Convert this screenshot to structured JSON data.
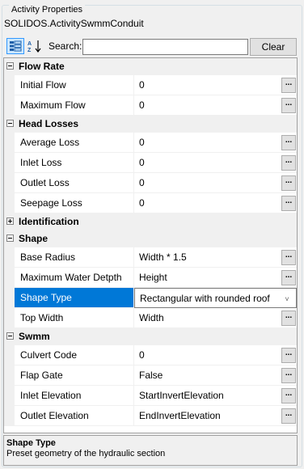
{
  "window": {
    "group_title": "Activity Properties",
    "object_name": "SOLIDOS.ActivitySwmmConduit"
  },
  "toolbar": {
    "categorized_icon": "categorized-view-icon",
    "alphabetical_icon": "alphabetical-sort-icon",
    "search_label": "Search:",
    "search_value": "",
    "clear_label": "Clear"
  },
  "grid": {
    "categories": [
      {
        "label": "Flow Rate",
        "expanded": true,
        "props": [
          {
            "name": "Initial Flow",
            "value": "0",
            "editor": "ellipsis"
          },
          {
            "name": "Maximum Flow",
            "value": "0",
            "editor": "ellipsis"
          }
        ]
      },
      {
        "label": "Head Losses",
        "expanded": true,
        "props": [
          {
            "name": "Average Loss",
            "value": "0",
            "editor": "ellipsis"
          },
          {
            "name": "Inlet Loss",
            "value": "0",
            "editor": "ellipsis"
          },
          {
            "name": "Outlet Loss",
            "value": "0",
            "editor": "ellipsis"
          },
          {
            "name": "Seepage Loss",
            "value": "0",
            "editor": "ellipsis"
          }
        ]
      },
      {
        "label": "Identification",
        "expanded": false,
        "props": []
      },
      {
        "label": "Shape",
        "expanded": true,
        "props": [
          {
            "name": "Base Radius",
            "value": "Width * 1.5",
            "editor": "ellipsis"
          },
          {
            "name": "Maximum Water Detpth",
            "value": "Height",
            "editor": "ellipsis"
          },
          {
            "name": "Shape Type",
            "value": "Rectangular with rounded roof",
            "editor": "dropdown",
            "selected": true
          },
          {
            "name": "Top Width",
            "value": "Width",
            "editor": "ellipsis"
          }
        ]
      },
      {
        "label": "Swmm",
        "expanded": true,
        "props": [
          {
            "name": "Culvert Code",
            "value": "0",
            "editor": "ellipsis"
          },
          {
            "name": "Flap Gate",
            "value": "False",
            "editor": "ellipsis"
          },
          {
            "name": "Inlet Elevation",
            "value": "StartInvertElevation",
            "editor": "ellipsis"
          },
          {
            "name": "Outlet Elevation",
            "value": "EndInvertElevation",
            "editor": "ellipsis"
          }
        ]
      }
    ],
    "ellipsis_label": "...",
    "dropdown_glyph": "˅"
  },
  "help": {
    "title": "Shape Type",
    "description": "Preset geometry of the hydraulic section"
  },
  "colors": {
    "selection": "#0078d7",
    "categorized_active": "#cce8ff"
  }
}
